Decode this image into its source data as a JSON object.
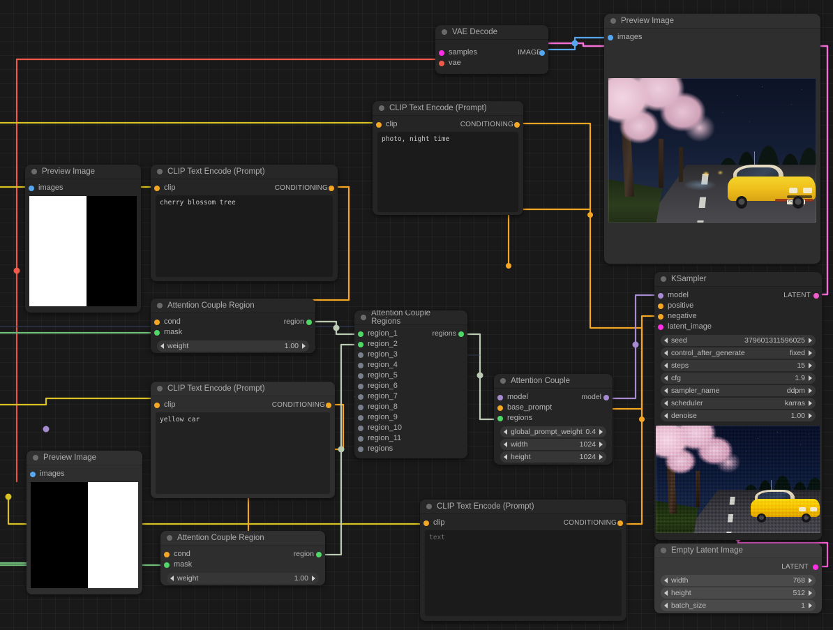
{
  "app": {
    "name": "ComfyUI",
    "canvas_bg": "#191919"
  },
  "colors": {
    "image": "#56a7f0",
    "latent": "#ff2fe6",
    "conditioning": "#f5a623",
    "model": "#a78bd0",
    "vae": "#f05a4a",
    "mask": "#4fd866",
    "region": "#4fd866",
    "clip": "#f5d423",
    "disconnected": "#7a7f8c"
  },
  "nodes": {
    "vae_decode": {
      "title": "VAE Decode",
      "inputs": [
        {
          "label": "samples",
          "type": "latent"
        },
        {
          "label": "vae",
          "type": "vae"
        }
      ],
      "outputs": [
        {
          "label": "IMAGE",
          "type": "image"
        }
      ]
    },
    "preview_image_main": {
      "title": "Preview Image",
      "inputs": [
        {
          "label": "images",
          "type": "image"
        }
      ],
      "image": {
        "alt": "night road lined with cherry blossom trees, yellow coupe car",
        "plate_text": "YGT 1988"
      }
    },
    "preview_image_mask1": {
      "title": "Preview Image",
      "inputs": [
        {
          "label": "images",
          "type": "image"
        }
      ],
      "image": {
        "alt": "mask: white left half, black right half"
      }
    },
    "preview_image_mask2": {
      "title": "Preview Image",
      "inputs": [
        {
          "label": "images",
          "type": "image"
        }
      ],
      "image": {
        "alt": "mask: black left half, white right half"
      }
    },
    "clip_encode_night": {
      "title": "CLIP Text Encode (Prompt)",
      "inputs": [
        {
          "label": "clip",
          "type": "clip"
        }
      ],
      "outputs": [
        {
          "label": "CONDITIONING",
          "type": "conditioning"
        }
      ],
      "text": "photo, night time",
      "is_placeholder": false
    },
    "clip_encode_cherry": {
      "title": "CLIP Text Encode (Prompt)",
      "inputs": [
        {
          "label": "clip",
          "type": "clip"
        }
      ],
      "outputs": [
        {
          "label": "CONDITIONING",
          "type": "conditioning"
        }
      ],
      "text": "cherry blossom tree",
      "is_placeholder": false
    },
    "clip_encode_car": {
      "title": "CLIP Text Encode (Prompt)",
      "inputs": [
        {
          "label": "clip",
          "type": "clip"
        }
      ],
      "outputs": [
        {
          "label": "CONDITIONING",
          "type": "conditioning"
        }
      ],
      "text": "yellow car",
      "is_placeholder": false
    },
    "clip_encode_empty": {
      "title": "CLIP Text Encode (Prompt)",
      "inputs": [
        {
          "label": "clip",
          "type": "clip"
        }
      ],
      "outputs": [
        {
          "label": "CONDITIONING",
          "type": "conditioning"
        }
      ],
      "text": "text",
      "is_placeholder": true
    },
    "attention_couple_region_1": {
      "title": "Attention Couple Region",
      "inputs": [
        {
          "label": "cond",
          "type": "conditioning"
        },
        {
          "label": "mask",
          "type": "mask"
        }
      ],
      "outputs": [
        {
          "label": "region",
          "type": "region"
        }
      ],
      "widgets": [
        {
          "name": "weight",
          "value": "1.00"
        }
      ]
    },
    "attention_couple_region_2": {
      "title": "Attention Couple Region",
      "inputs": [
        {
          "label": "cond",
          "type": "conditioning"
        },
        {
          "label": "mask",
          "type": "mask"
        }
      ],
      "outputs": [
        {
          "label": "region",
          "type": "region"
        }
      ],
      "widgets": [
        {
          "name": "weight",
          "value": "1.00"
        }
      ]
    },
    "attention_couple_regions": {
      "title": "Attention Couple Regions",
      "inputs": [
        {
          "label": "region_1",
          "type": "region",
          "connected": true
        },
        {
          "label": "region_2",
          "type": "region",
          "connected": true
        },
        {
          "label": "region_3",
          "type": "region",
          "connected": false
        },
        {
          "label": "region_4",
          "type": "region",
          "connected": false
        },
        {
          "label": "region_5",
          "type": "region",
          "connected": false
        },
        {
          "label": "region_6",
          "type": "region",
          "connected": false
        },
        {
          "label": "region_7",
          "type": "region",
          "connected": false
        },
        {
          "label": "region_8",
          "type": "region",
          "connected": false
        },
        {
          "label": "region_9",
          "type": "region",
          "connected": false
        },
        {
          "label": "region_10",
          "type": "region",
          "connected": false
        },
        {
          "label": "region_11",
          "type": "region",
          "connected": false
        },
        {
          "label": "regions",
          "type": "region",
          "connected": false
        }
      ],
      "outputs": [
        {
          "label": "regions",
          "type": "region"
        }
      ]
    },
    "attention_couple": {
      "title": "Attention Couple",
      "inputs": [
        {
          "label": "model",
          "type": "model"
        },
        {
          "label": "base_prompt",
          "type": "conditioning"
        },
        {
          "label": "regions",
          "type": "region"
        }
      ],
      "outputs": [
        {
          "label": "model",
          "type": "model"
        }
      ],
      "widgets": [
        {
          "name": "global_prompt_weight",
          "value": "0.4"
        },
        {
          "name": "width",
          "value": "1024"
        },
        {
          "name": "height",
          "value": "1024"
        }
      ]
    },
    "ksampler": {
      "title": "KSampler",
      "inputs": [
        {
          "label": "model",
          "type": "model"
        },
        {
          "label": "positive",
          "type": "conditioning"
        },
        {
          "label": "negative",
          "type": "conditioning"
        },
        {
          "label": "latent_image",
          "type": "latent"
        }
      ],
      "outputs": [
        {
          "label": "LATENT",
          "type": "latent"
        }
      ],
      "widgets": [
        {
          "name": "seed",
          "value": "379601311596025"
        },
        {
          "name": "control_after_generate",
          "value": "fixed"
        },
        {
          "name": "steps",
          "value": "15"
        },
        {
          "name": "cfg",
          "value": "1.9"
        },
        {
          "name": "sampler_name",
          "value": "ddpm"
        },
        {
          "name": "scheduler",
          "value": "karras"
        },
        {
          "name": "denoise",
          "value": "1.00"
        }
      ],
      "preview": {
        "alt": "noisy in-progress preview of cherry blossom road with yellow car"
      }
    },
    "empty_latent_image": {
      "title": "Empty Latent Image",
      "outputs": [
        {
          "label": "LATENT",
          "type": "latent"
        }
      ],
      "widgets": [
        {
          "name": "width",
          "value": "768"
        },
        {
          "name": "height",
          "value": "512"
        },
        {
          "name": "batch_size",
          "value": "1"
        }
      ]
    }
  }
}
